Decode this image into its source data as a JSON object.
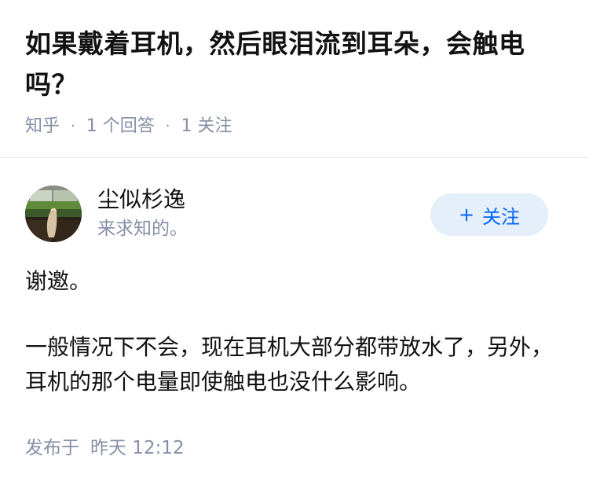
{
  "question": {
    "title": "如果戴着耳机，然后眼泪流到耳朵，会触电吗？",
    "source": "知乎",
    "separator": "·",
    "answers_count": "1 个回答",
    "followers_count": "1 关注"
  },
  "author": {
    "name": "尘似杉逸",
    "bio": "来求知的。",
    "follow_label": "关注",
    "follow_icon": "+"
  },
  "answer": {
    "paragraphs": [
      "谢邀。",
      "一般情况下不会，现在耳机大部分都带放水了，另外，耳机的那个电量即使触电也没什么影响。"
    ]
  },
  "footer": {
    "published_label": "发布于",
    "published_time": "昨天 12:12"
  },
  "colors": {
    "text_primary": "#121212",
    "text_secondary": "#8590a6",
    "accent_blue": "#0066ff",
    "button_bg": "#e5eff9",
    "divider": "#ebebeb"
  }
}
